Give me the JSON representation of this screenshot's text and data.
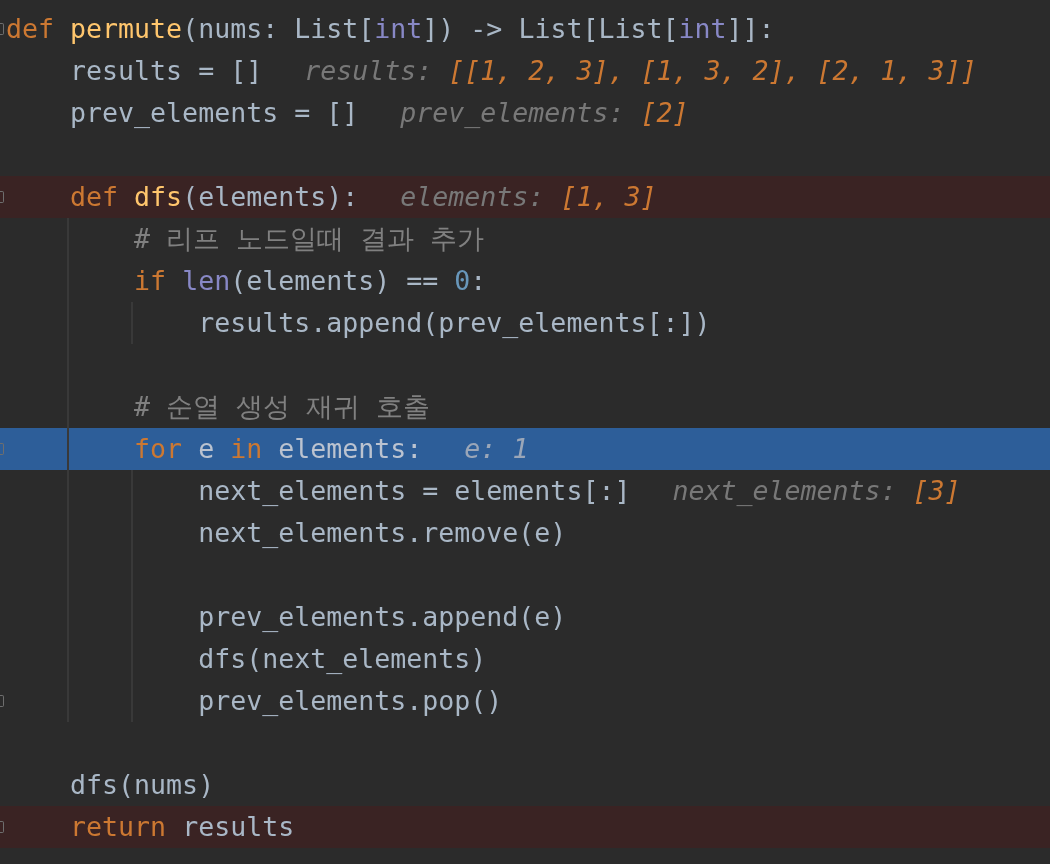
{
  "editor": {
    "lines": [
      {
        "breakpoint": false,
        "execution_point": false,
        "fold_marker": true,
        "tokens": [
          {
            "text": "def ",
            "kind": "keyword"
          },
          {
            "text": "permute",
            "kind": "function"
          },
          {
            "text": "(nums: List[",
            "kind": "plain"
          },
          {
            "text": "int",
            "kind": "builtin"
          },
          {
            "text": "]) -> List[List[",
            "kind": "plain"
          },
          {
            "text": "int",
            "kind": "builtin"
          },
          {
            "text": "]]:",
            "kind": "plain"
          }
        ]
      },
      {
        "breakpoint": false,
        "execution_point": false,
        "fold_marker": false,
        "tokens": [
          {
            "text": "    results = []",
            "kind": "plain"
          }
        ],
        "inline_value": {
          "name": "results:",
          "value": "[[1, 2, 3], [1, 3, 2], [2, 1, 3]]"
        }
      },
      {
        "breakpoint": false,
        "execution_point": false,
        "fold_marker": false,
        "tokens": [
          {
            "text": "    prev_elements = []",
            "kind": "plain"
          }
        ],
        "inline_value": {
          "name": "prev_elements:",
          "value": "[2]"
        }
      },
      {
        "breakpoint": false,
        "execution_point": false,
        "fold_marker": false
      },
      {
        "breakpoint": true,
        "execution_point": false,
        "fold_marker": true,
        "tokens": [
          {
            "text": "    def ",
            "kind": "keyword"
          },
          {
            "text": "dfs",
            "kind": "function"
          },
          {
            "text": "(elements):",
            "kind": "plain"
          }
        ],
        "inline_value": {
          "name": "elements:",
          "value": "[1, 3]"
        }
      },
      {
        "breakpoint": false,
        "execution_point": false,
        "fold_marker": false,
        "tokens": [
          {
            "text": "        # 리프 노드일때 결과 추가",
            "kind": "comment"
          }
        ]
      },
      {
        "breakpoint": false,
        "execution_point": false,
        "fold_marker": false,
        "tokens": [
          {
            "text": "        if ",
            "kind": "keyword"
          },
          {
            "text": "len",
            "kind": "builtin"
          },
          {
            "text": "(elements) == ",
            "kind": "plain"
          },
          {
            "text": "0",
            "kind": "number"
          },
          {
            "text": ":",
            "kind": "plain"
          }
        ]
      },
      {
        "breakpoint": false,
        "execution_point": false,
        "fold_marker": false,
        "tokens": [
          {
            "text": "            results.append(prev_elements[:])",
            "kind": "plain"
          }
        ]
      },
      {
        "breakpoint": false,
        "execution_point": false,
        "fold_marker": false
      },
      {
        "breakpoint": false,
        "execution_point": false,
        "fold_marker": false,
        "tokens": [
          {
            "text": "        # 순열 생성 재귀 호출",
            "kind": "comment"
          }
        ]
      },
      {
        "breakpoint": false,
        "execution_point": true,
        "fold_marker": true,
        "tokens": [
          {
            "text": "        for ",
            "kind": "keyword"
          },
          {
            "text": "e ",
            "kind": "plain"
          },
          {
            "text": "in ",
            "kind": "keyword"
          },
          {
            "text": "elements:",
            "kind": "plain"
          }
        ],
        "inline_value": {
          "name": "e:",
          "value": "1"
        }
      },
      {
        "breakpoint": false,
        "execution_point": false,
        "fold_marker": false,
        "tokens": [
          {
            "text": "            next_elements = elements[:]",
            "kind": "plain"
          }
        ],
        "inline_value": {
          "name": "next_elements:",
          "value": "[3]"
        }
      },
      {
        "breakpoint": false,
        "execution_point": false,
        "fold_marker": false,
        "tokens": [
          {
            "text": "            next_elements.remove(e)",
            "kind": "plain"
          }
        ]
      },
      {
        "breakpoint": false,
        "execution_point": false,
        "fold_marker": false
      },
      {
        "breakpoint": false,
        "execution_point": false,
        "fold_marker": false,
        "tokens": [
          {
            "text": "            prev_elements.append(e)",
            "kind": "plain"
          }
        ]
      },
      {
        "breakpoint": false,
        "execution_point": false,
        "fold_marker": false,
        "tokens": [
          {
            "text": "            dfs(next_elements)",
            "kind": "plain"
          }
        ]
      },
      {
        "breakpoint": false,
        "execution_point": false,
        "fold_marker": true,
        "tokens": [
          {
            "text": "            prev_elements.pop()",
            "kind": "plain"
          }
        ]
      },
      {
        "breakpoint": false,
        "execution_point": false,
        "fold_marker": false
      },
      {
        "breakpoint": false,
        "execution_point": false,
        "fold_marker": false,
        "tokens": [
          {
            "text": "    dfs(nums)",
            "kind": "plain"
          }
        ]
      },
      {
        "breakpoint": true,
        "execution_point": false,
        "fold_marker": true,
        "tokens": [
          {
            "text": "    return ",
            "kind": "keyword"
          },
          {
            "text": "results",
            "kind": "plain"
          }
        ]
      }
    ]
  }
}
